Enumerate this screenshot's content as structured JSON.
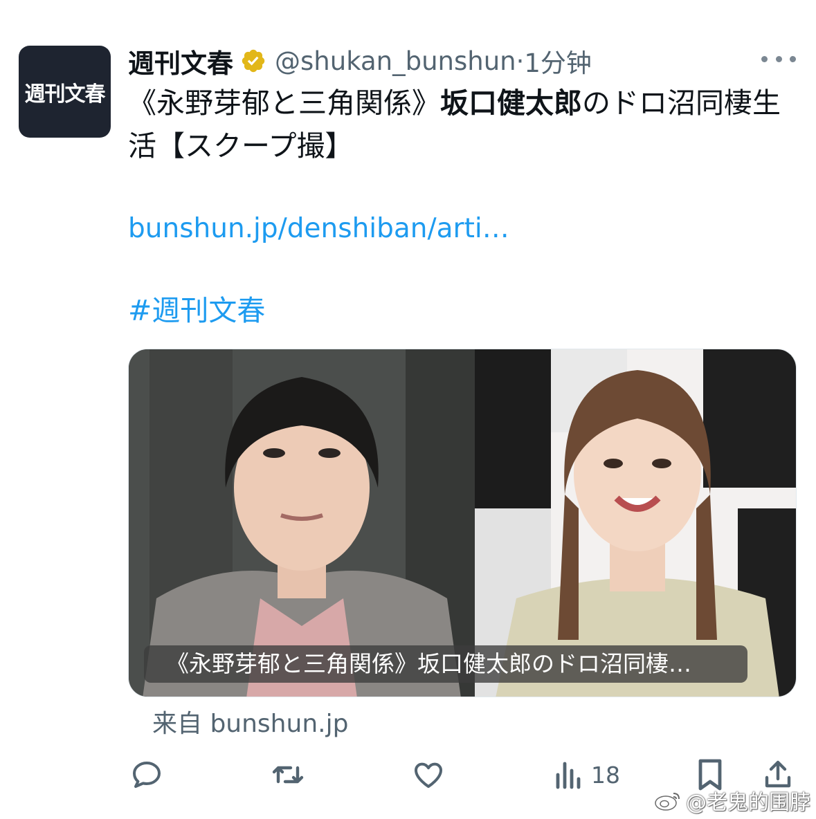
{
  "account": {
    "avatar_text": "週刊文春",
    "display_name": "週刊文春",
    "verified_icon": "verified-badge-gold",
    "handle": "@shukan_bunshun",
    "separator": "·",
    "time": "1分钟"
  },
  "tweet": {
    "text_part1": "《永野芽郁と三角関係》",
    "text_bold": "坂口健太郎",
    "text_part2": "のドロ沼同棲生活【スクープ撮】",
    "link": "bunshun.jp/denshiban/arti…",
    "hashtag": "#週刊文春"
  },
  "card": {
    "title": "《永野芽郁と三角関係》坂口健太郎のドロ沼同棲…",
    "source": "来自 bunshun.jp"
  },
  "actions": {
    "view_count": "18"
  },
  "watermark": {
    "text": "@老鬼的围脖"
  },
  "colors": {
    "link": "#1d9bf0",
    "secondary_text": "#536471",
    "verified_gold": "#e2b719"
  }
}
